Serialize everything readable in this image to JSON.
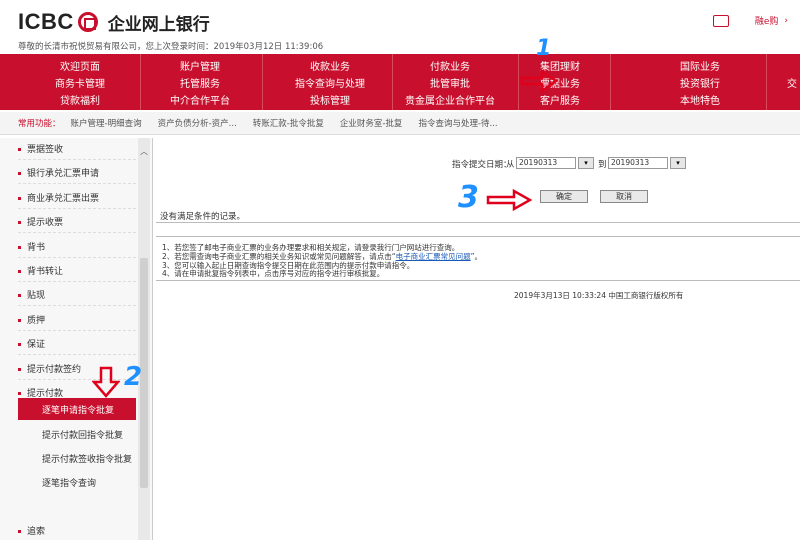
{
  "header": {
    "brand": "ICBC",
    "title": "企业网上银行",
    "welcome": "尊敬的长清市祝悦贸易有限公司，您上次登录时间：2019年03月12日 11:39:06",
    "cart_label": "",
    "hint": "融e购"
  },
  "nav": {
    "rows": [
      [
        "欢迎页面",
        "账户管理",
        "收款业务",
        "付款业务",
        "集团理财",
        "国际业务"
      ],
      [
        "商务卡管理",
        "托管服务",
        "指令查询与处理",
        "批管审批",
        "票据业务",
        "投资银行",
        "交"
      ],
      [
        "贷款福利",
        "中介合作平台",
        "投标管理",
        "贵金属企业合作平台",
        "客户服务",
        "本地特色"
      ]
    ]
  },
  "quick": {
    "label": "常用功能：",
    "items": [
      "账户管理-明细查询",
      "资产负债分析-资产...",
      "转账汇款-批令批复",
      "企业财务室-批复",
      "指令查询与处理-待..."
    ]
  },
  "sidebar": {
    "items": [
      "票据签收",
      "银行承兑汇票申请",
      "商业承兑汇票出票",
      "提示收票",
      "背书",
      "背书转让",
      "贴现",
      "质押",
      "保证",
      "提示付款签约",
      "提示付款"
    ],
    "subitems": [
      "逐笔申请指令批复",
      "提示付款回指令批复",
      "提示付款签收指令批复",
      "逐笔指令查询"
    ],
    "bottom_item": "追索"
  },
  "main": {
    "date_label": "指令提交日期：",
    "from_label": "从",
    "from_value": "20190313",
    "to_label": "到",
    "to_value": "20190313",
    "confirm": "确定",
    "cancel": "取消",
    "no_result": "没有满足条件的记录。",
    "tips": [
      "1、若您签了邮电子商业汇票的业务办理要求和相关规定，请登录我行门户网站进行查询。",
      "2、若您需查询电子商业汇票的相关业务知识或常见问题解答，请点击“",
      "3、您可以输入起止日期查询指令提交日期在此范围内的提示付款申请指令。",
      "4、请在申请批复指令列表中，点击序号对应的指令进行审核批复。"
    ],
    "tips_link": "电子商业汇票常见问题",
    "tips_link_tail": "”。",
    "footer": "2019年3月13日  10:33:24     中国工商银行版权所有"
  },
  "annotations": [
    "1",
    "2",
    "3"
  ],
  "colors": {
    "brand_red": "#c8102e",
    "annotation_blue": "#1e90ff"
  }
}
